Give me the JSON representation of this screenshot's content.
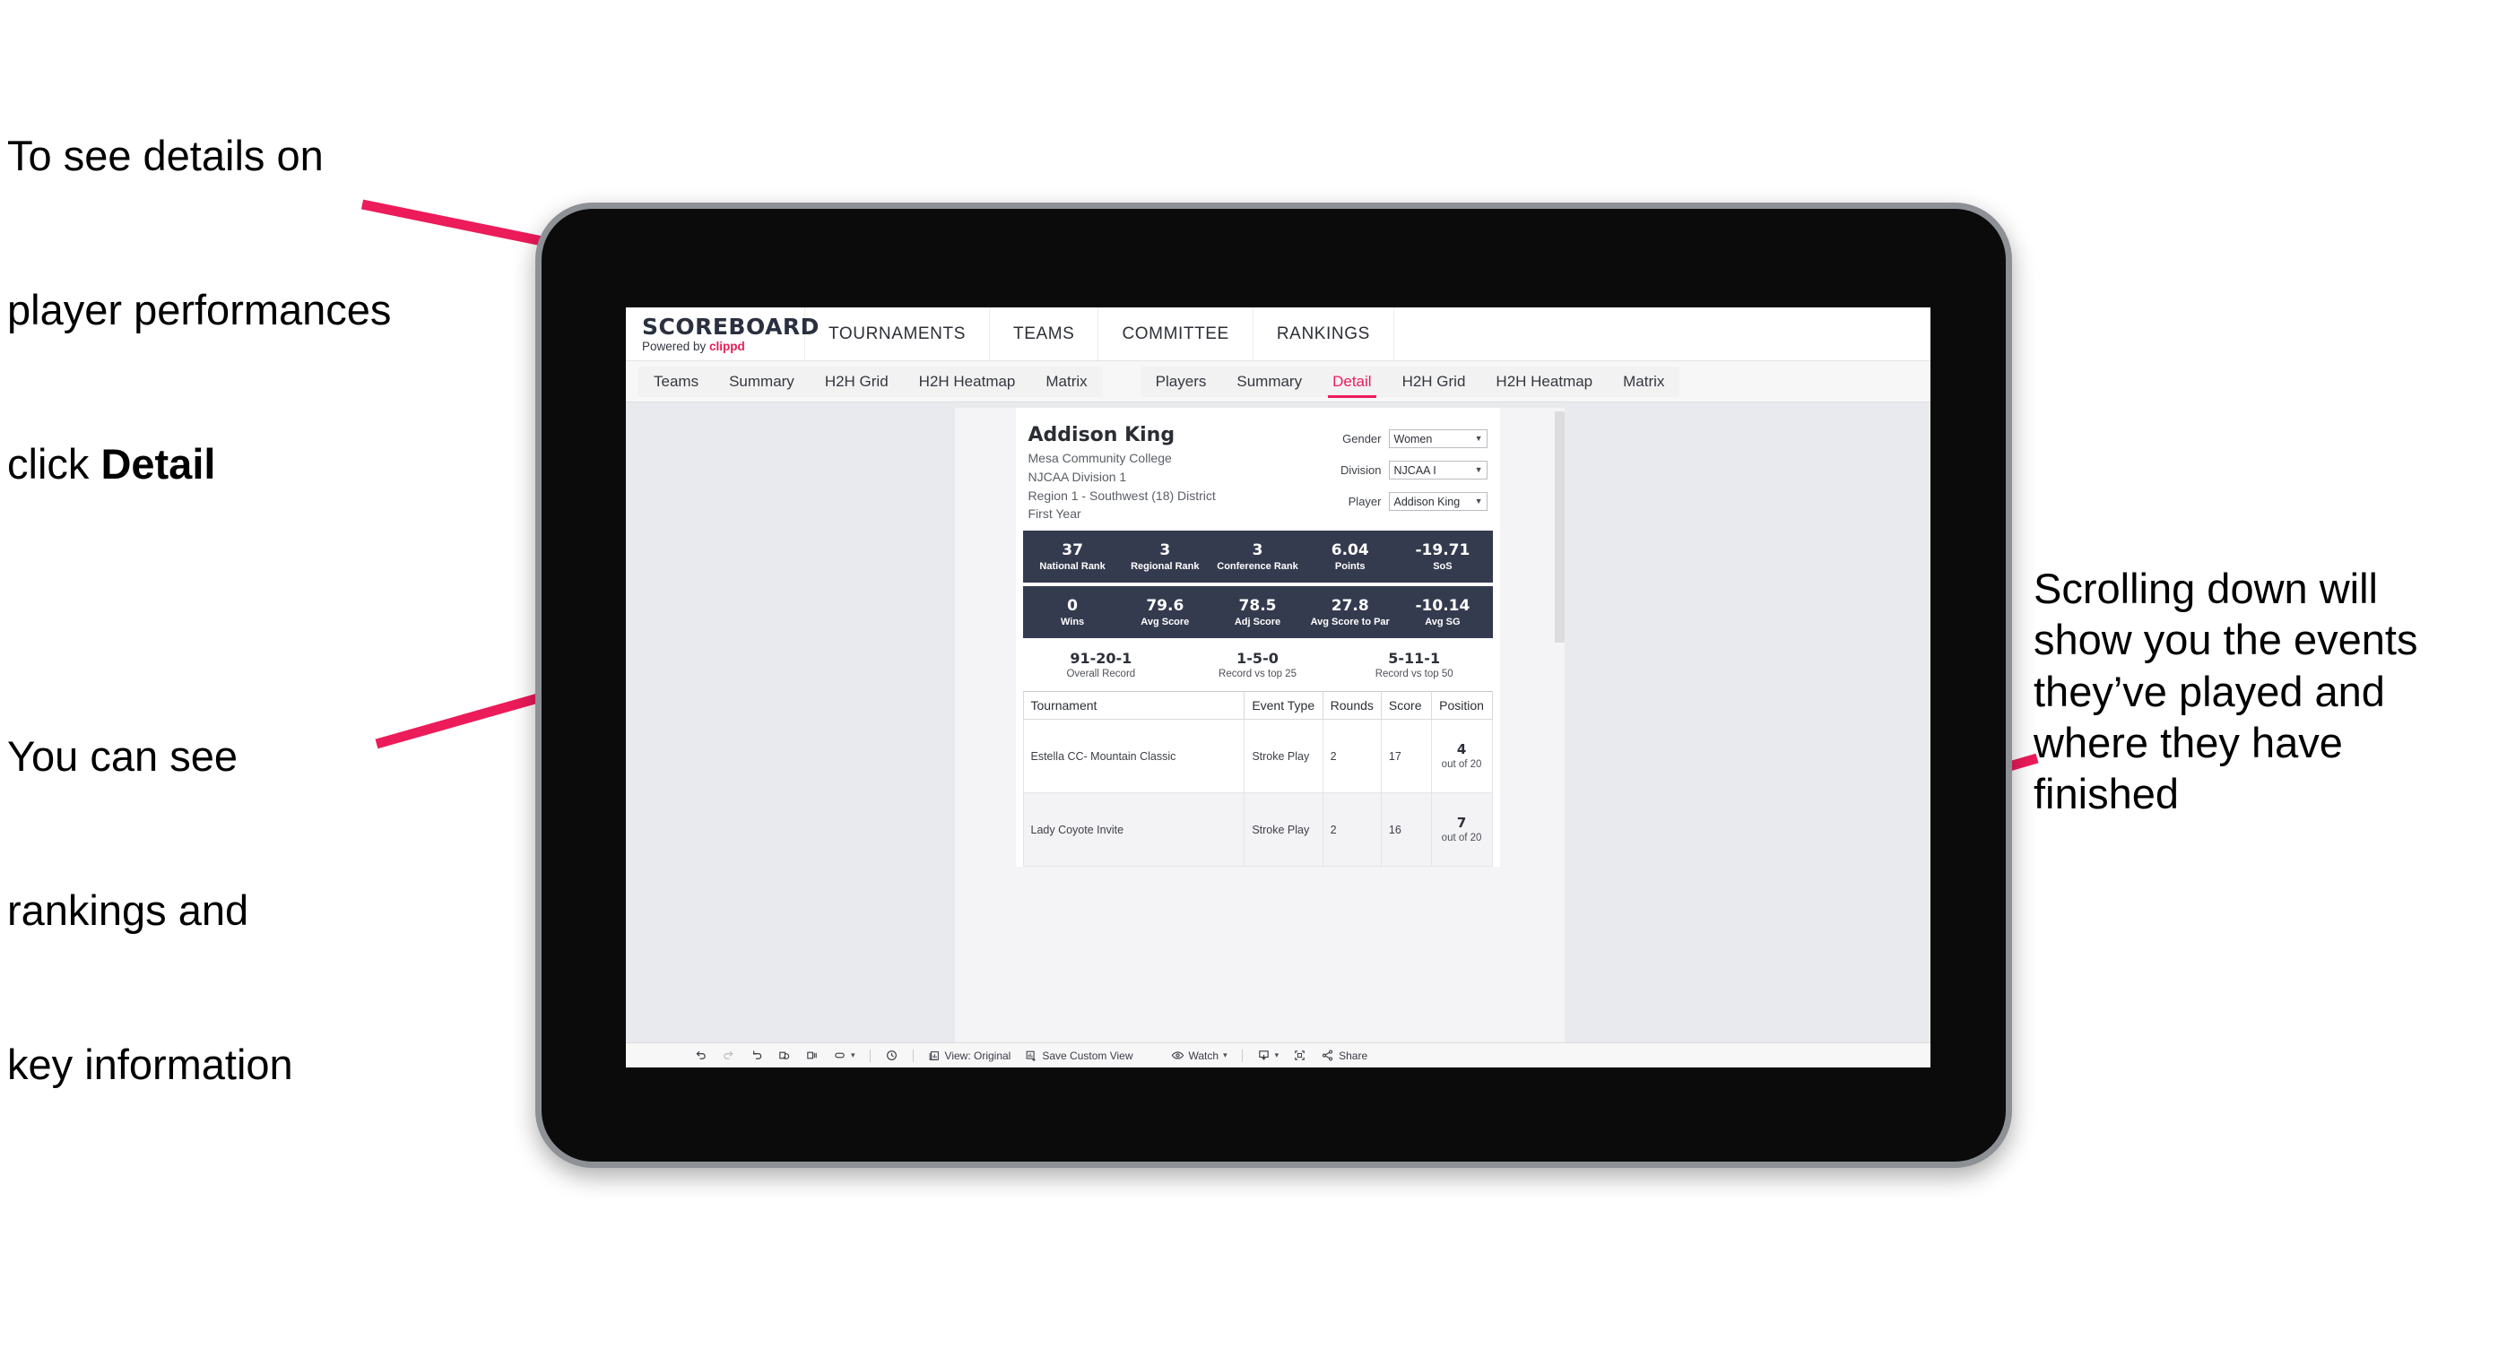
{
  "annotations": {
    "top_left": {
      "line1": "To see details on",
      "line2": "player performances",
      "line3_prefix": "click ",
      "line3_bold": "Detail"
    },
    "bottom_left": {
      "line1": "You can see",
      "line2": "rankings and",
      "line3": "key information"
    },
    "right": {
      "text": "Scrolling down will show you the events they’ve played and where they have finished"
    }
  },
  "app": {
    "brand": {
      "title": "SCOREBOARD",
      "powered_prefix": "Powered by ",
      "powered_brand": "clippd"
    },
    "top_nav": [
      "TOURNAMENTS",
      "TEAMS",
      "COMMITTEE",
      "RANKINGS"
    ],
    "tabs_teams": [
      "Teams",
      "Summary",
      "H2H Grid",
      "H2H Heatmap",
      "Matrix"
    ],
    "tabs_players": [
      "Players",
      "Summary",
      "Detail",
      "H2H Grid",
      "H2H Heatmap",
      "Matrix"
    ],
    "active_tab": "Detail",
    "accent_color": "#ec1b5a",
    "band_color": "#353b4f"
  },
  "player": {
    "name": "Addison King",
    "school": "Mesa Community College",
    "division": "NJCAA Division 1",
    "region": "Region 1 - Southwest (18) District",
    "year": "First Year"
  },
  "filters": [
    {
      "label": "Gender",
      "value": "Women"
    },
    {
      "label": "Division",
      "value": "NJCAA I"
    },
    {
      "label": "Player",
      "value": "Addison King"
    }
  ],
  "stats_band_1": [
    {
      "value": "37",
      "label": "National Rank"
    },
    {
      "value": "3",
      "label": "Regional Rank"
    },
    {
      "value": "3",
      "label": "Conference Rank"
    },
    {
      "value": "6.04",
      "label": "Points"
    },
    {
      "value": "-19.71",
      "label": "SoS"
    }
  ],
  "stats_band_2": [
    {
      "value": "0",
      "label": "Wins"
    },
    {
      "value": "79.6",
      "label": "Avg Score"
    },
    {
      "value": "78.5",
      "label": "Adj Score"
    },
    {
      "value": "27.8",
      "label": "Avg Score to Par"
    },
    {
      "value": "-10.14",
      "label": "Avg SG"
    }
  ],
  "records": [
    {
      "value": "91-20-1",
      "label": "Overall Record"
    },
    {
      "value": "1-5-0",
      "label": "Record vs top 25"
    },
    {
      "value": "5-11-1",
      "label": "Record vs top 50"
    }
  ],
  "events_table": {
    "headers": [
      "Tournament",
      "Event Type",
      "Rounds",
      "Score",
      "Position"
    ],
    "rows": [
      {
        "tournament": "Estella CC- Mountain Classic",
        "event_type": "Stroke Play",
        "rounds": "2",
        "score": "17",
        "position_num": "4",
        "position_of": "out of 20"
      },
      {
        "tournament": "Lady Coyote Invite",
        "event_type": "Stroke Play",
        "rounds": "2",
        "score": "16",
        "position_num": "7",
        "position_of": "out of 20"
      }
    ]
  },
  "toolbar": {
    "view_label": "View: Original",
    "save_label": "Save Custom View",
    "watch_label": "Watch",
    "share_label": "Share"
  }
}
